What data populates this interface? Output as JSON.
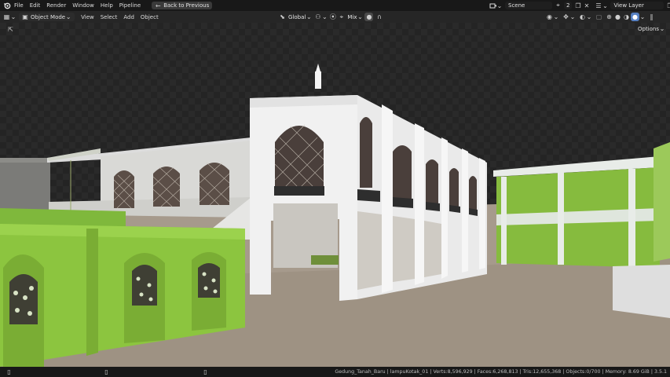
{
  "menubar": {
    "items": [
      "File",
      "Edit",
      "Render",
      "Window",
      "Help",
      "Pipeline"
    ],
    "back_button": "Back to Previous",
    "scene_label": "Scene",
    "scene_users": "2",
    "view_layer_label": "View Layer"
  },
  "header": {
    "mode": "Object Mode",
    "menus": [
      "View",
      "Select",
      "Add",
      "Object"
    ],
    "orientation": "Global",
    "snap_mode": "Mix",
    "options_label": "Options"
  },
  "statusbar": {
    "info": "Gedung_Tanah_Baru | lampuKotak_01 | Verts:8,596,929 | Faces:6,268,813 | Tris:12,655,368 | Objects:0/700 | Memory: 8.69 GiB | 3.5.1"
  },
  "icons": {
    "blender": "blender-logo-icon",
    "editor": "editor-type-icon",
    "mode": "object-mode-icon",
    "transform": "transform-orientation-icon",
    "pivot": "pivot-point-icon",
    "snap": "snap-icon",
    "proportional": "proportional-editing-icon"
  },
  "colors": {
    "accent": "#5680c2",
    "ground": "#a69a8c",
    "green_wall": "#8cc53f",
    "building_white": "#eeeeee"
  }
}
